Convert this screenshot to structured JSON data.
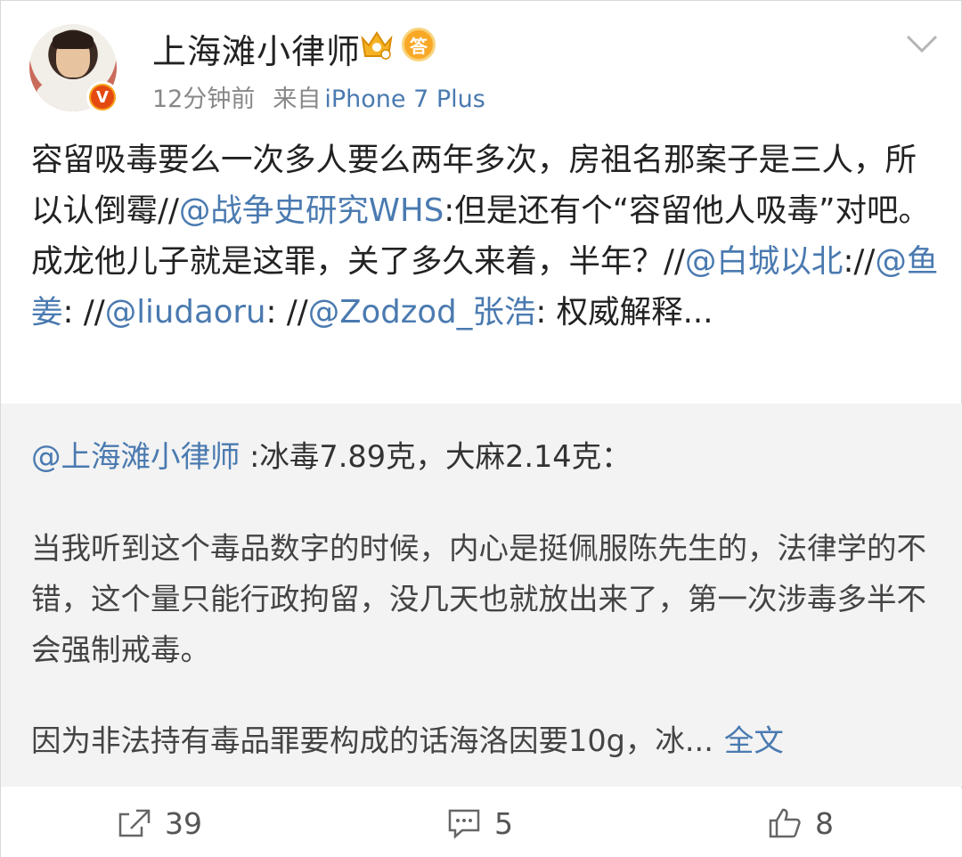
{
  "post": {
    "author": "上海滩小律师",
    "time": "12分钟前",
    "source_prefix": "来自",
    "device": "iPhone 7 Plus",
    "badge_text": "答",
    "verified_text": "V",
    "content": {
      "t1": "容留吸毒要么一次多人要么两年多次，房祖名那案子是三人，所以认倒霉//",
      "m1": "@战争史研究WHS",
      "t2": ":但是还有个“容留他人吸毒”对吧。成龙他儿子就是这罪，关了多久来着，半年？//",
      "m2": "@白城以北",
      "t3": "://",
      "m3": "@鱼姜",
      "t4": ": //",
      "m4": "@liudaoru",
      "t5": ": //",
      "m5": "@Zodzod_张浩",
      "t6": ": 权威解释..."
    }
  },
  "quoted": {
    "mention": "@上海滩小律师",
    "head_text": " :冰毒7.89克，大麻2.14克：",
    "paragraph1": "当我听到这个毒品数字的时候，内心是挺佩服陈先生的，法律学的不错，这个量只能行政拘留，没几天也就放出来了，第一次涉毒多半不会强制戒毒。",
    "paragraph2": "因为非法持有毒品罪要构成的话海洛因要10g，冰...",
    "more_label": "全文"
  },
  "actions": {
    "share_count": "39",
    "comment_count": "5",
    "like_count": "8"
  },
  "colors": {
    "link": "#4a7ab0",
    "quote_bg": "#f3f3f3",
    "badge_orange": "#f9a826"
  },
  "icons": [
    "avatar",
    "verified-badge-icon",
    "crown-icon",
    "answer-badge-icon",
    "chevron-down-icon",
    "share-icon",
    "comment-icon",
    "like-icon"
  ]
}
